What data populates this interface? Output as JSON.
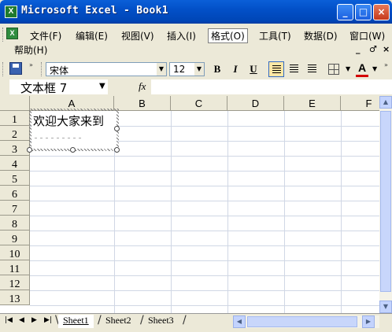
{
  "window": {
    "title": "Microsoft Excel - Book1",
    "app_icon": "excel-icon",
    "controls": [
      "_",
      "□",
      "×"
    ]
  },
  "menu": {
    "items": [
      "文件(F)",
      "编辑(E)",
      "视图(V)",
      "插入(I)",
      "格式(O)",
      "工具(T)",
      "数据(D)",
      "窗口(W)"
    ],
    "second_row": "帮助(H)",
    "active_item": "格式(O)",
    "doc_controls": [
      "_",
      "♂",
      "×"
    ]
  },
  "toolbar": {
    "font_name": "宋体",
    "font_size": "12",
    "bold": "B",
    "italic": "I",
    "underline": "U",
    "font_color_label": "A",
    "font_color": "#d40000"
  },
  "formula_bar": {
    "name_box": "文本框 7",
    "fx_label": "fx",
    "formula": ""
  },
  "grid": {
    "columns": [
      "A",
      "B",
      "C",
      "D",
      "E",
      "F"
    ],
    "rows": [
      "1",
      "2",
      "3",
      "4",
      "5",
      "6",
      "7",
      "8",
      "9",
      "10",
      "11",
      "12",
      "13"
    ]
  },
  "textbox": {
    "text": "欢迎大家来到"
  },
  "sheets": {
    "tabs": [
      "Sheet1",
      "Sheet2",
      "Sheet3"
    ],
    "active": "Sheet1"
  },
  "colors": {
    "titlebar": "#0054e3",
    "chrome": "#ece9d8",
    "gridline": "#d0d7e5"
  }
}
